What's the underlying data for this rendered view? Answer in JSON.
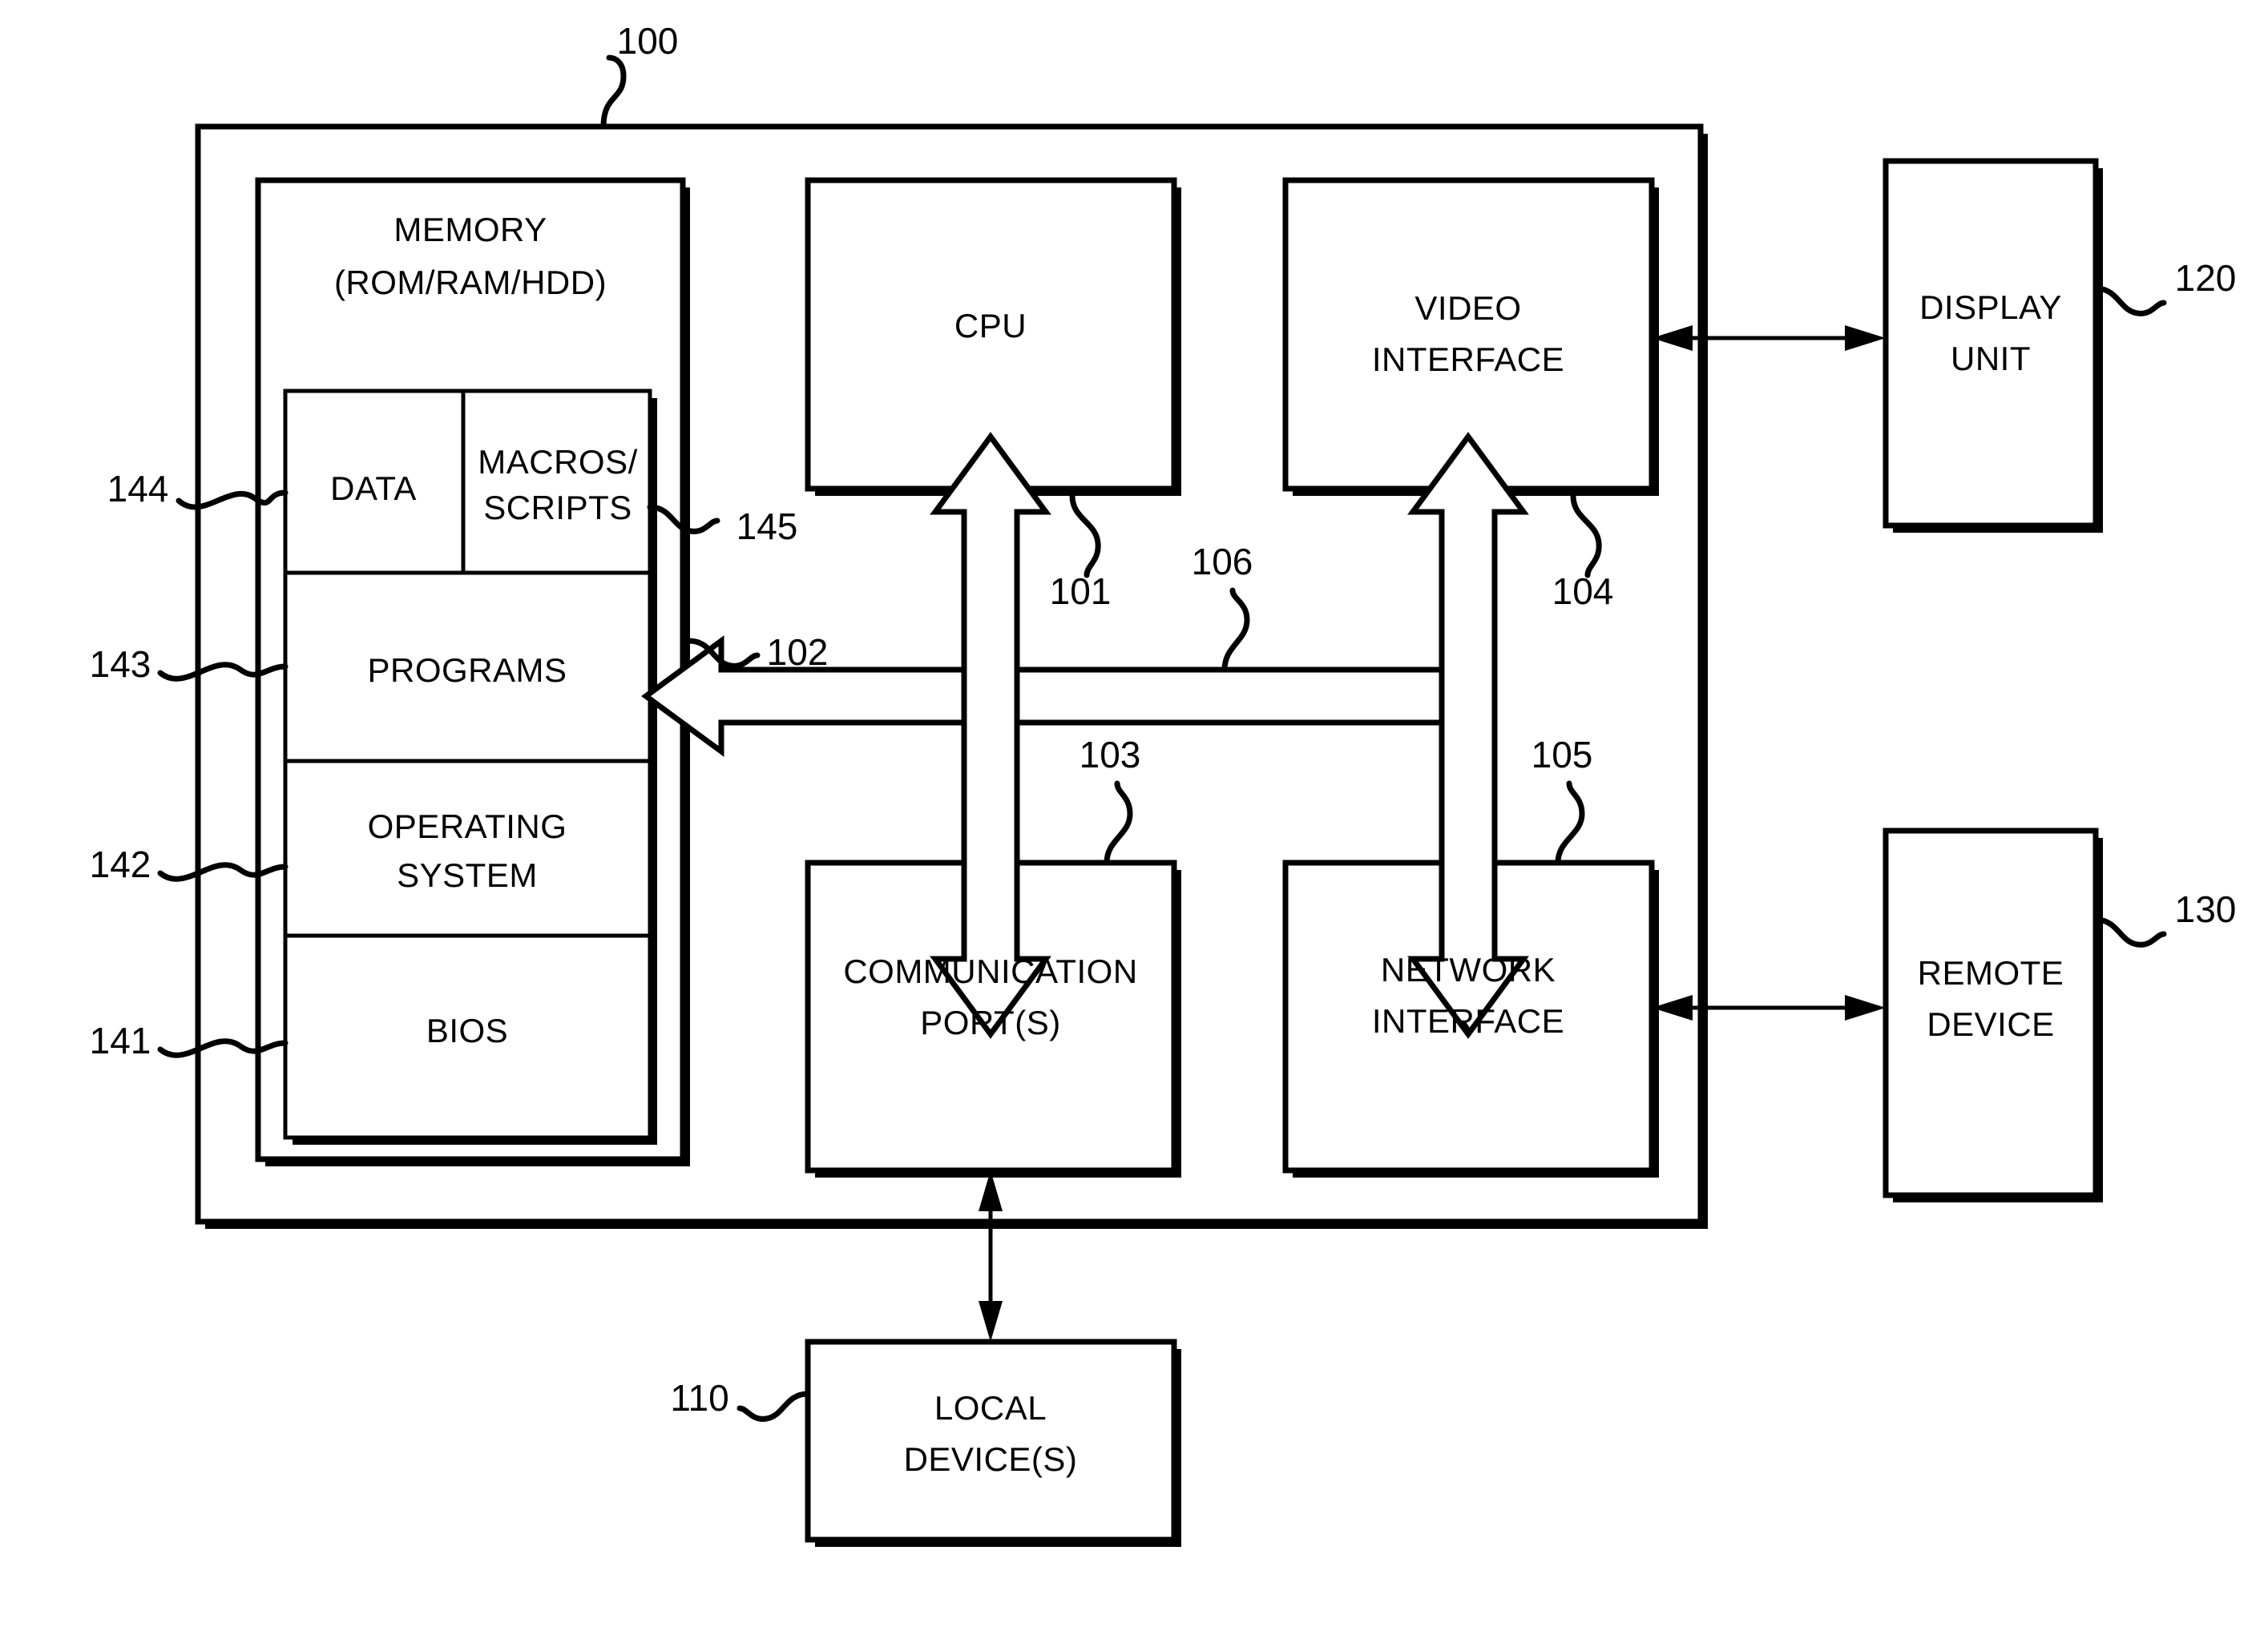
{
  "figure": {
    "title": "Computer system block diagram",
    "system_ref": "100"
  },
  "blocks": {
    "memory": {
      "label_line1": "MEMORY",
      "label_line2": "(ROM/RAM/HDD)"
    },
    "data": {
      "label": "DATA",
      "ref": "144"
    },
    "macros_scripts": {
      "label_line1": "MACROS/",
      "label_line2": "SCRIPTS",
      "ref": "145"
    },
    "programs": {
      "label": "PROGRAMS",
      "ref": "143"
    },
    "operating_system": {
      "label_line1": "OPERATING",
      "label_line2": "SYSTEM",
      "ref": "142"
    },
    "bios": {
      "label": "BIOS",
      "ref": "141"
    },
    "cpu": {
      "label": "CPU",
      "ref": "101"
    },
    "video_interface": {
      "label_line1": "VIDEO",
      "label_line2": "INTERFACE",
      "ref": "104"
    },
    "communication_ports": {
      "label_line1": "COMMUNICATION",
      "label_line2": "PORT(S)",
      "ref": "103"
    },
    "network_interface": {
      "label_line1": "NETWORK",
      "label_line2": "INTERFACE",
      "ref": "105"
    },
    "display_unit": {
      "label_line1": "DISPLAY",
      "label_line2": "UNIT",
      "ref": "120"
    },
    "remote_device": {
      "label_line1": "REMOTE",
      "label_line2": "DEVICE",
      "ref": "130"
    },
    "local_devices": {
      "label_line1": "LOCAL",
      "label_line2": "DEVICE(S)",
      "ref": "110"
    }
  },
  "connections": {
    "memory_bus": {
      "ref": "102"
    },
    "system_bus": {
      "ref": "106"
    }
  },
  "reference_numerals": [
    "100",
    "101",
    "102",
    "103",
    "104",
    "105",
    "106",
    "110",
    "120",
    "130",
    "141",
    "142",
    "143",
    "144",
    "145"
  ],
  "colors": {
    "stroke": "#000000",
    "fill": "#ffffff"
  }
}
